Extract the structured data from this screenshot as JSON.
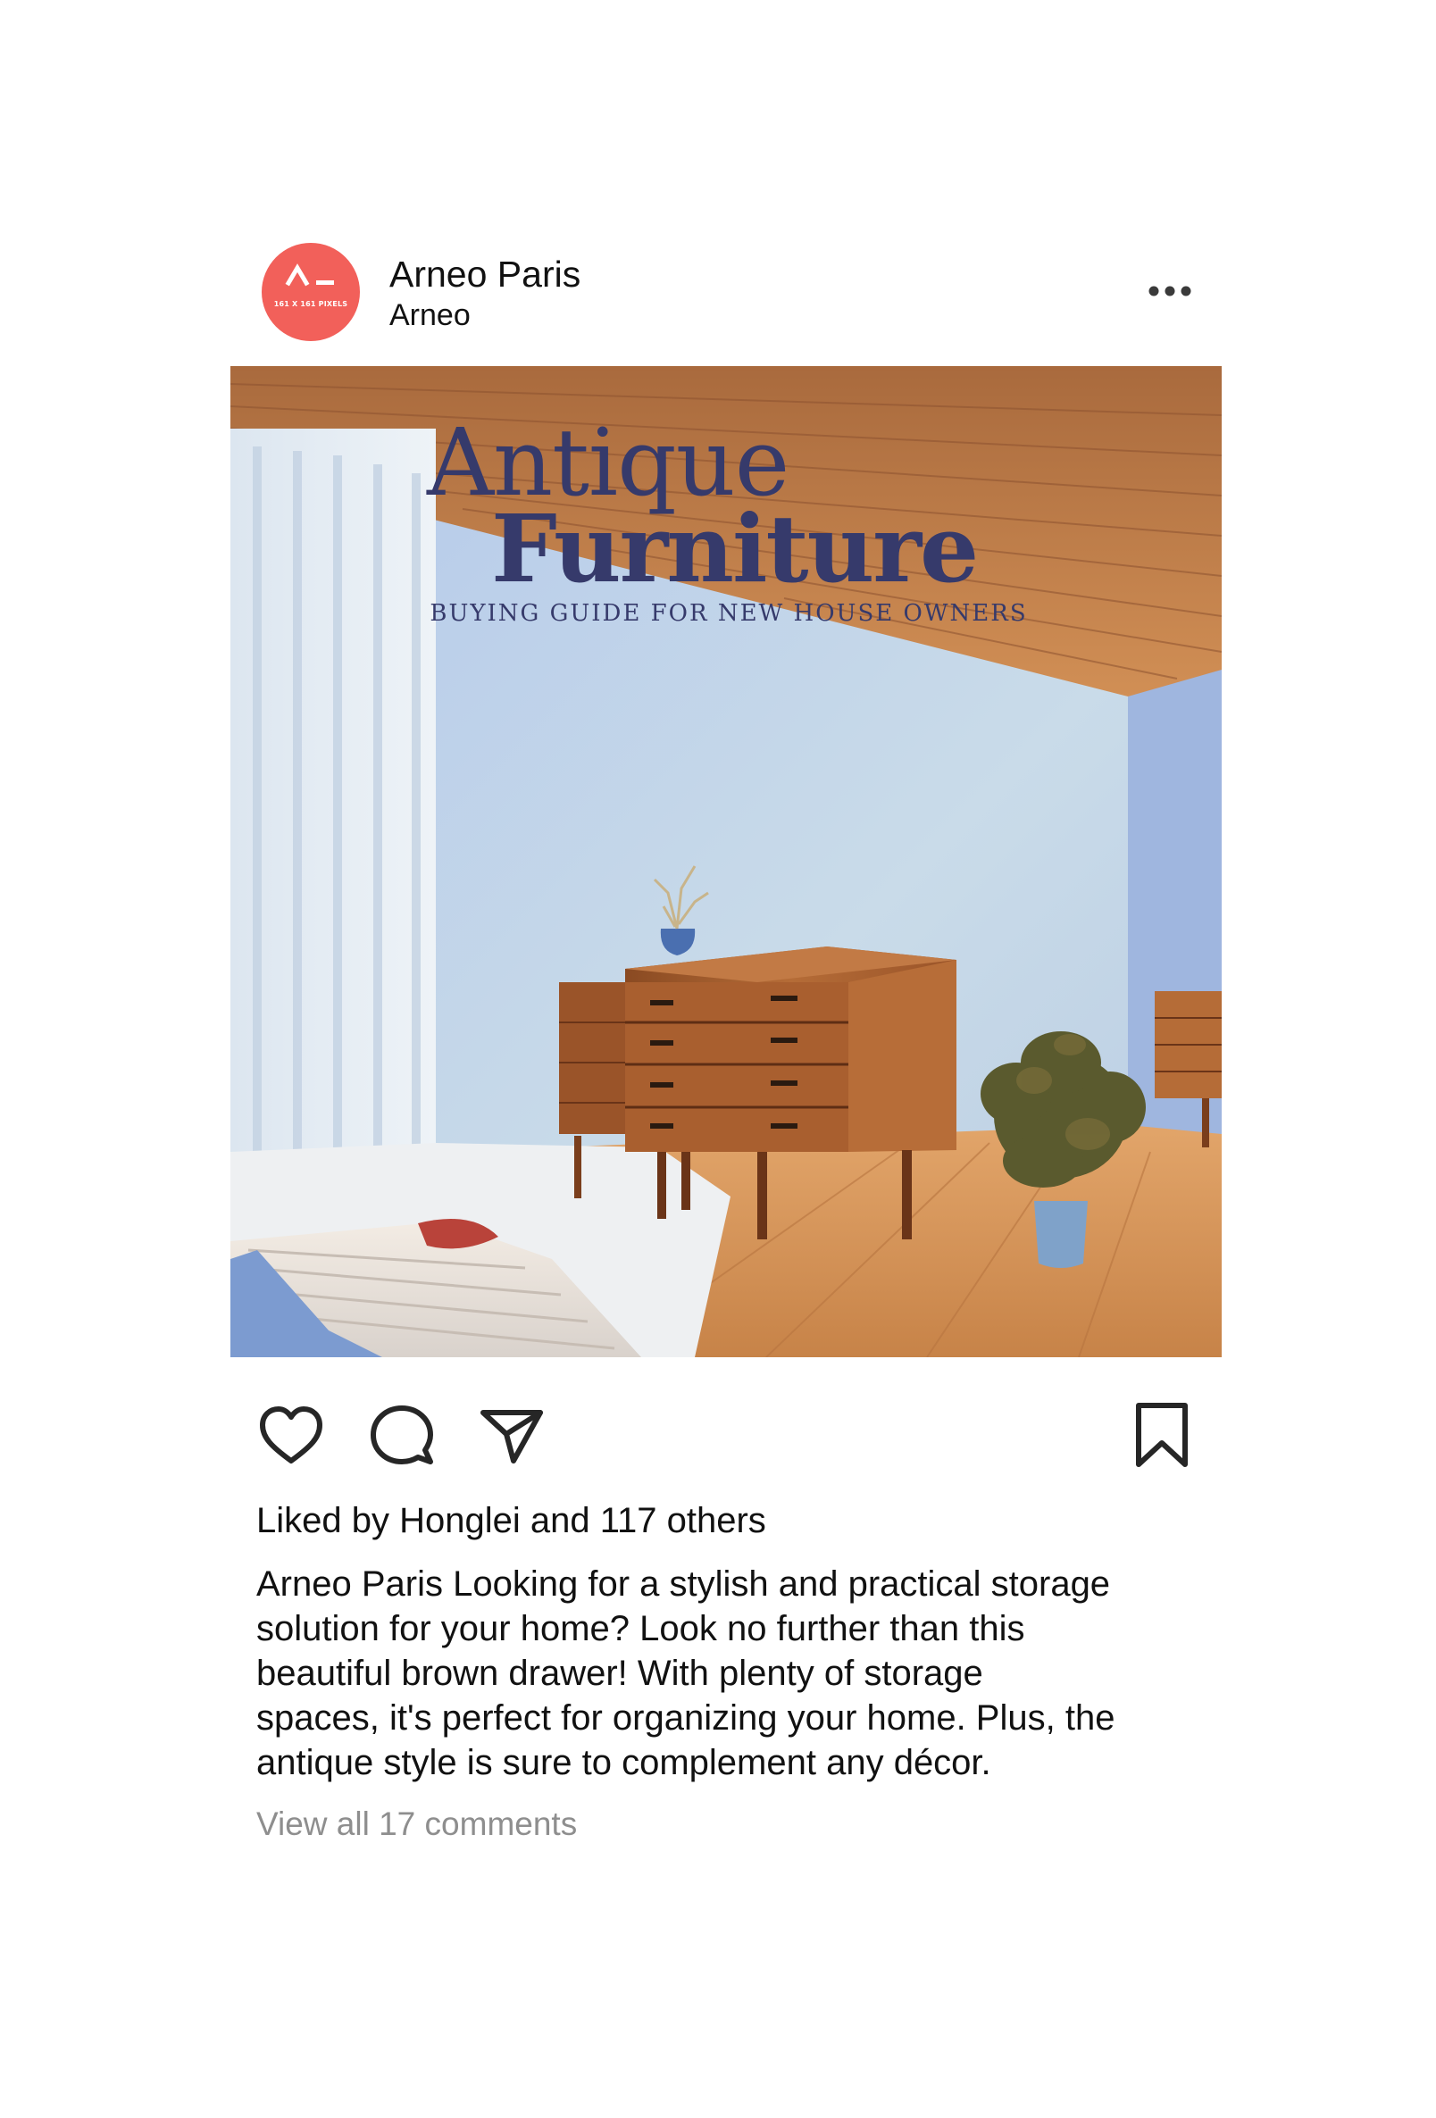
{
  "post": {
    "account": {
      "name": "Arneo Paris",
      "subtitle": "Arneo",
      "avatar_caption": "161 X 161 PIXELS",
      "avatar_color": "#f2605a"
    },
    "menu_icon": "more-horizontal-icon",
    "image": {
      "title_line1": "Antique",
      "title_line2": "Furniture",
      "subtitle": "BUYING GUIDE FOR NEW HOUSE OWNERS",
      "title_color": "#363a6b"
    },
    "actions": {
      "like_icon": "heart-icon",
      "comment_icon": "comment-icon",
      "share_icon": "send-icon",
      "save_icon": "bookmark-icon"
    },
    "likes_text": "Liked by Honglei and 117 others",
    "caption_lines": [
      "Arneo Paris Looking for a stylish and practical storage",
      "solution for your home? Look no further than this",
      "beautiful brown drawer! With plenty of storage",
      "spaces, it's perfect for organizing your home. Plus, the",
      "antique style is sure to complement any décor."
    ],
    "view_comments_text": "View all 17 comments"
  }
}
